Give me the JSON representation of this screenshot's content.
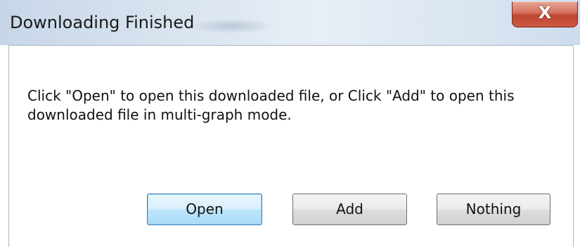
{
  "window": {
    "title": "Downloading Finished",
    "close_glyph": "X",
    "close_icon": "close-icon"
  },
  "dialog": {
    "message": "Click \"Open\" to open this downloaded file, or Click \"Add\" to open this downloaded file in multi-graph mode."
  },
  "buttons": {
    "open_label": "Open",
    "add_label": "Add",
    "nothing_label": "Nothing"
  },
  "colors": {
    "close_button": "#cc5a41",
    "default_button_border": "#3c7fb1",
    "titlebar": "#dbe6f1"
  }
}
